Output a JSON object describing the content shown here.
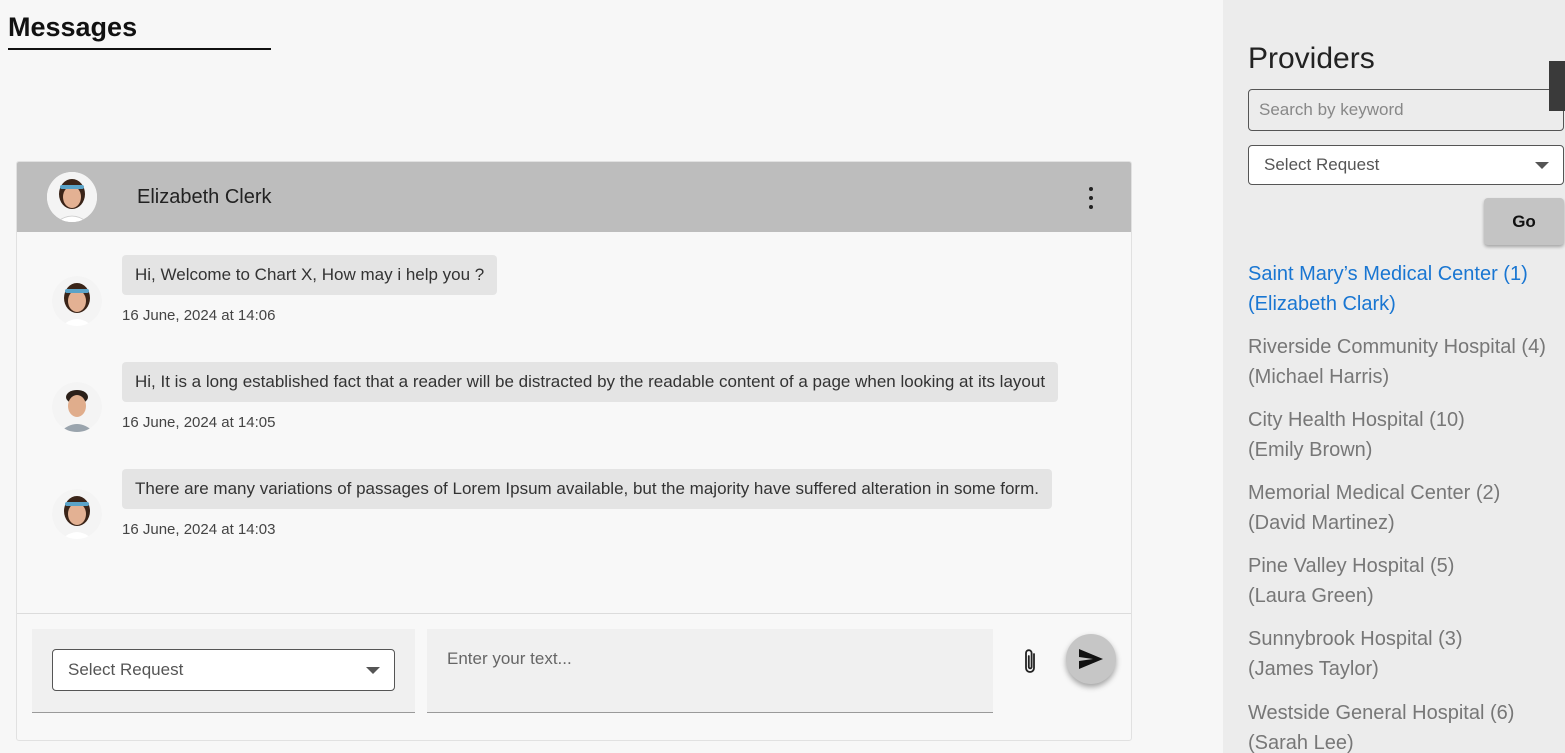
{
  "page": {
    "title": "Messages"
  },
  "chat": {
    "contact_name": "Elizabeth Clerk",
    "messages": [
      {
        "text": "Hi, Welcome to Chart X, How may i help you ?",
        "time": "16 June, 2024 at 14:06",
        "sender": "female-avatar"
      },
      {
        "text": "Hi, It is a long established fact that a reader will be distracted by the readable content of a page when looking at its layout",
        "time": "16 June, 2024 at 14:05",
        "sender": "male-avatar"
      },
      {
        "text": "There are many variations of passages of Lorem Ipsum available, but the majority have suffered alteration in some form.",
        "time": "16 June, 2024 at 14:03",
        "sender": "female-avatar"
      }
    ],
    "composer": {
      "select_label": "Select Request",
      "text_placeholder": "Enter your text..."
    }
  },
  "sidebar": {
    "title": "Providers",
    "search_placeholder": "Search by keyword",
    "select_label": "Select Request",
    "go_label": "Go",
    "providers": [
      {
        "name": "Saint Mary’s Medical Center (1)",
        "contact": "(Elizabeth Clark)",
        "active": true
      },
      {
        "name": "Riverside Community Hospital (4)",
        "contact": "(Michael Harris)"
      },
      {
        "name": "City Health Hospital (10)",
        "contact": "(Emily Brown)"
      },
      {
        "name": "Memorial Medical Center (2)",
        "contact": "(David Martinez)"
      },
      {
        "name": "Pine Valley Hospital (5)",
        "contact": "(Laura Green)"
      },
      {
        "name": "Sunnybrook Hospital (3)",
        "contact": "(James Taylor)"
      },
      {
        "name": "Westside General Hospital (6)",
        "contact": "(Sarah Lee)"
      }
    ]
  },
  "colors": {
    "accent": "#1976d2",
    "header_bg": "#bdbdbd",
    "sidebar_bg": "#ececec"
  }
}
